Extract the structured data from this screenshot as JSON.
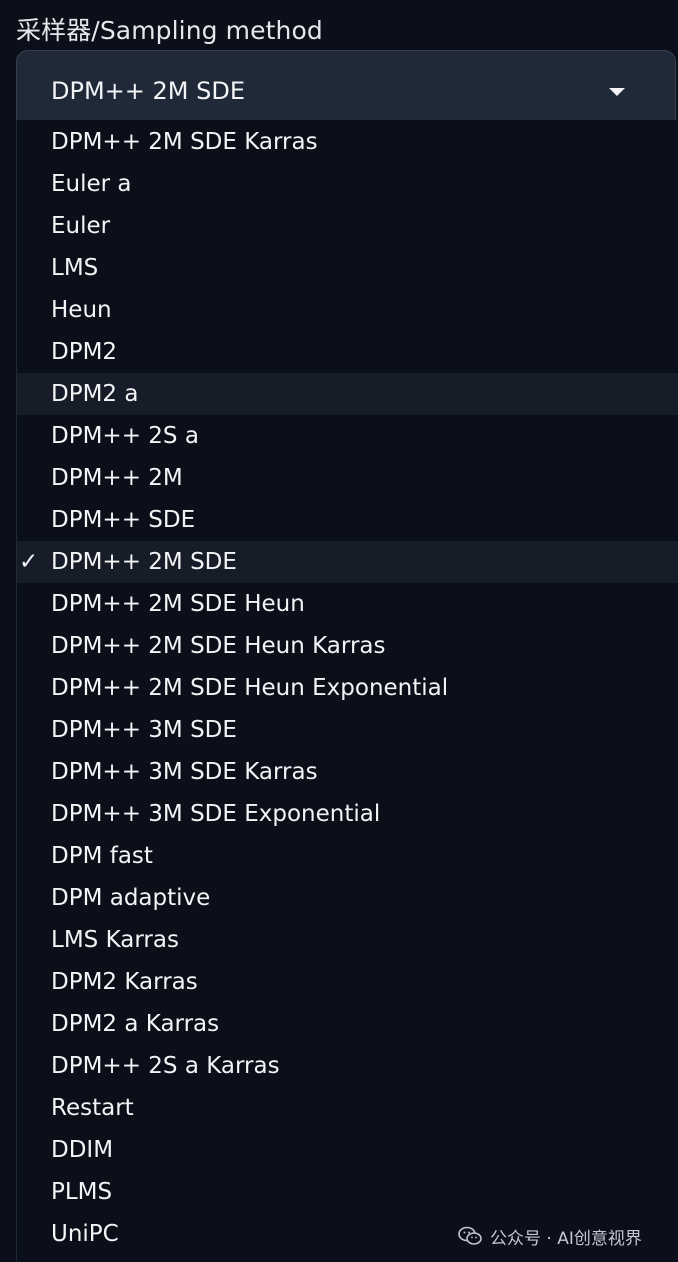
{
  "field": {
    "label": "采样器/Sampling method",
    "selected_value": "DPM++ 2M SDE"
  },
  "dropdown": {
    "check_glyph": "✓",
    "options": [
      {
        "label": "DPM++ 2M SDE Karras"
      },
      {
        "label": "Euler a"
      },
      {
        "label": "Euler"
      },
      {
        "label": "LMS"
      },
      {
        "label": "Heun"
      },
      {
        "label": "DPM2"
      },
      {
        "label": "DPM2 a",
        "state": "hover"
      },
      {
        "label": "DPM++ 2S a"
      },
      {
        "label": "DPM++ 2M"
      },
      {
        "label": "DPM++ SDE"
      },
      {
        "label": "DPM++ 2M SDE",
        "state": "selected"
      },
      {
        "label": "DPM++ 2M SDE Heun"
      },
      {
        "label": "DPM++ 2M SDE Heun Karras"
      },
      {
        "label": "DPM++ 2M SDE Heun Exponential"
      },
      {
        "label": "DPM++ 3M SDE"
      },
      {
        "label": "DPM++ 3M SDE Karras"
      },
      {
        "label": "DPM++ 3M SDE Exponential"
      },
      {
        "label": "DPM fast"
      },
      {
        "label": "DPM adaptive"
      },
      {
        "label": "LMS Karras"
      },
      {
        "label": "DPM2 Karras"
      },
      {
        "label": "DPM2 a Karras"
      },
      {
        "label": "DPM++ 2S a Karras"
      },
      {
        "label": "Restart"
      },
      {
        "label": "DDIM"
      },
      {
        "label": "PLMS"
      },
      {
        "label": "UniPC"
      }
    ]
  },
  "watermark": {
    "icon": "wechat-icon",
    "text": "公众号 · AI创意视界"
  },
  "colors": {
    "background": "#0b0f19",
    "select_bg": "#1f2937",
    "highlight_bg": "#161c28",
    "text": "#f3f4f6"
  }
}
